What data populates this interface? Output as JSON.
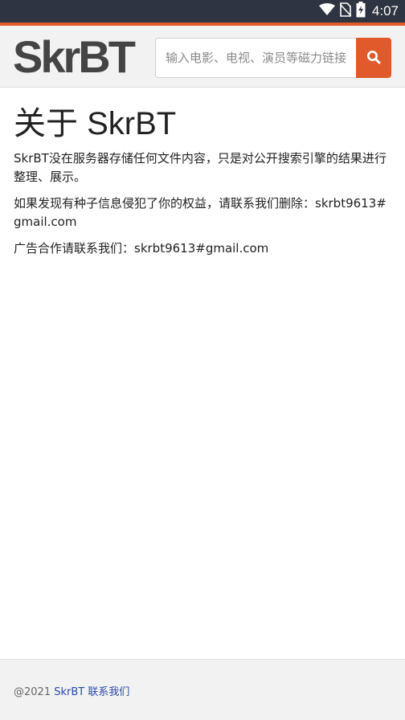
{
  "status_bar": {
    "time": "4:07"
  },
  "header": {
    "logo": "SkrBT",
    "search": {
      "placeholder": "输入电影、电视、演员等磁力链接",
      "value": ""
    },
    "search_button_icon": "search-icon"
  },
  "main": {
    "title": "关于 SkrBT",
    "paragraphs": [
      "SkrBT没在服务器存储任何文件内容，只是对公开搜索引擎的结果进行整理、展示。",
      "如果发现有种子信息侵犯了你的权益，请联系我们删除：skrbt9613#gmail.com",
      "广告合作请联系我们：skrbt9613#gmail.com"
    ]
  },
  "footer": {
    "copyright": "@2021",
    "site_link": "SkrBT",
    "contact_link": "联系我们"
  },
  "colors": {
    "accent": "#e05a2b",
    "status_bar": "#2e3441",
    "link": "#2a4aa8"
  }
}
